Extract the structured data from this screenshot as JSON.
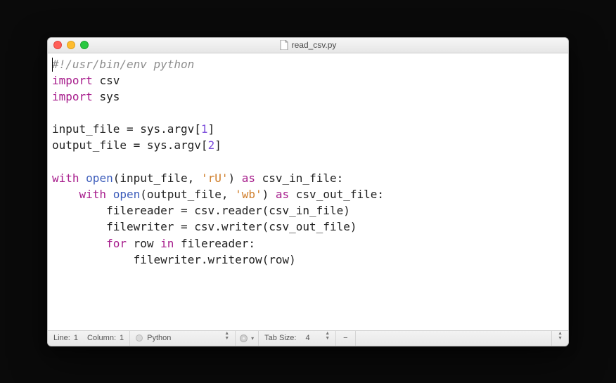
{
  "window": {
    "title": "read_csv.py"
  },
  "code": {
    "tokens": [
      [
        [
          "#!/usr/bin/env python",
          "comment"
        ]
      ],
      [
        [
          "import",
          "keyword"
        ],
        [
          " ",
          "name"
        ],
        [
          "csv",
          "name"
        ]
      ],
      [
        [
          "import",
          "keyword"
        ],
        [
          " ",
          "name"
        ],
        [
          "sys",
          "name"
        ]
      ],
      [],
      [
        [
          "input_file = sys.argv[",
          "name"
        ],
        [
          "1",
          "num"
        ],
        [
          "]",
          "name"
        ]
      ],
      [
        [
          "output_file = sys.argv[",
          "name"
        ],
        [
          "2",
          "num"
        ],
        [
          "]",
          "name"
        ]
      ],
      [],
      [
        [
          "with",
          "keyword"
        ],
        [
          " ",
          "name"
        ],
        [
          "open",
          "builtin"
        ],
        [
          "(input_file, ",
          "name"
        ],
        [
          "'rU'",
          "str"
        ],
        [
          ") ",
          "name"
        ],
        [
          "as",
          "keyword"
        ],
        [
          " csv_in_file:",
          "name"
        ]
      ],
      [
        [
          "    ",
          "name"
        ],
        [
          "with",
          "keyword"
        ],
        [
          " ",
          "name"
        ],
        [
          "open",
          "builtin"
        ],
        [
          "(output_file, ",
          "name"
        ],
        [
          "'wb'",
          "str"
        ],
        [
          ") ",
          "name"
        ],
        [
          "as",
          "keyword"
        ],
        [
          " csv_out_file:",
          "name"
        ]
      ],
      [
        [
          "        filereader = csv.reader(csv_in_file)",
          "name"
        ]
      ],
      [
        [
          "        filewriter = csv.writer(csv_out_file)",
          "name"
        ]
      ],
      [
        [
          "        ",
          "name"
        ],
        [
          "for",
          "keyword"
        ],
        [
          " row ",
          "name"
        ],
        [
          "in",
          "keyword"
        ],
        [
          " filereader:",
          "name"
        ]
      ],
      [
        [
          "            filewriter.writerow(row)",
          "name"
        ]
      ]
    ]
  },
  "status": {
    "line_label": "Line:",
    "line": "1",
    "col_label": "Column:",
    "col": "1",
    "language": "Python",
    "tabsize_label": "Tab Size:",
    "tabsize": "4",
    "wrapminus": "−"
  }
}
